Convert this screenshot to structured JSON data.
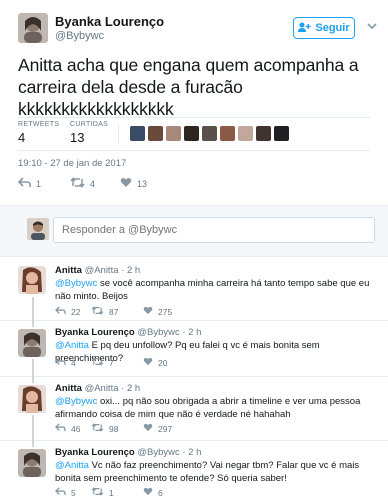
{
  "tweet": {
    "author_name": "Byanka Lourenço",
    "author_handle": "@Bybywc",
    "follow_label": "Seguir",
    "text": "Anitta acha que engana quem acompanha a carreira dela desde a furacão kkkkkkkkkkkkkkkkkk",
    "retweets_label": "RETWEETS",
    "retweets": "4",
    "likes_label": "CURTIDAS",
    "likes": "13",
    "timestamp": "19:10 - 27 de jan de 2017",
    "action_reply_count": "1",
    "action_retweet_count": "4",
    "action_like_count": "13"
  },
  "reply_box": {
    "placeholder": "Responder a @Bybywc"
  },
  "replies": [
    {
      "name": "Anitta",
      "handle": "@Anitta",
      "time": "· 2 h",
      "mention": "@Bybywc",
      "text": " se você acompanha minha carreira há tanto tempo sabe que eu não minto. Beijos",
      "reply_count": "22",
      "retweet_count": "87",
      "like_count": "275"
    },
    {
      "name": "Byanka Lourenço",
      "handle": "@Bybywc",
      "time": "· 2 h",
      "mention": "@Anitta",
      "text": " E pq deu unfollow? Pq eu falei q vc é mais bonita sem preenchimento?",
      "reply_count": "4",
      "retweet_count": "7",
      "like_count": "20"
    },
    {
      "name": "Anitta",
      "handle": "@Anitta",
      "time": "· 2 h",
      "mention": "@Bybywc",
      "text": " oxi... pq não sou obrigada a abrir a timeline e ver uma pessoa afirmando coisa de mim que não é verdade né hahahah",
      "reply_count": "46",
      "retweet_count": "98",
      "like_count": "297"
    },
    {
      "name": "Byanka Lourenço",
      "handle": "@Bybywc",
      "time": "· 2 h",
      "mention": "@Anitta",
      "text": " Vc não faz preenchimento? Vai negar tbm? Falar que vc é mais bonita sem preenchimento te ofende? Só queria saber!",
      "reply_count": "5",
      "retweet_count": "1",
      "like_count": "6"
    }
  ],
  "colors": {
    "accent": "#1da1f2",
    "muted": "#657786",
    "divider": "#e6ecf0",
    "reply_bg": "#f5f8fa"
  }
}
